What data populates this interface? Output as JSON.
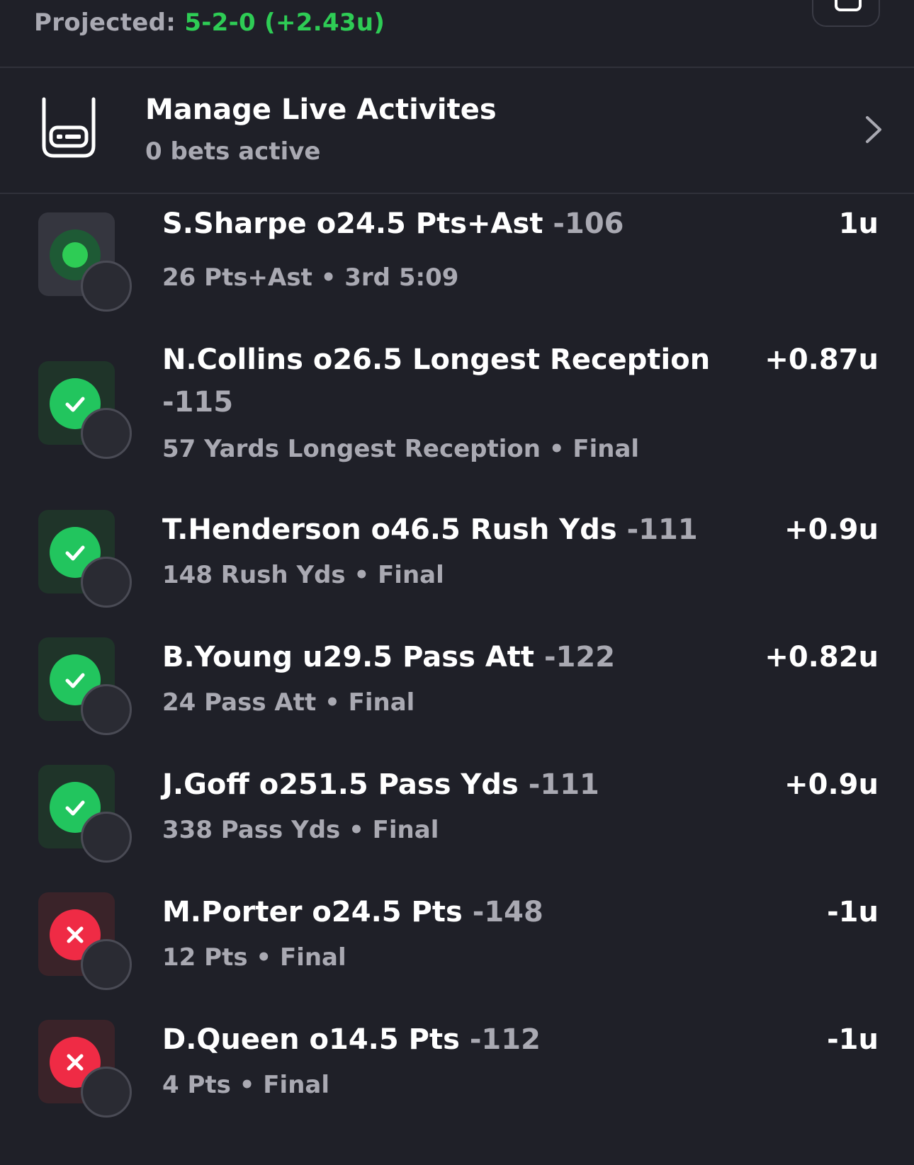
{
  "header": {
    "projected_label": "Projected:",
    "projected_value": "5-2-0 (+2.43u)"
  },
  "live_activities": {
    "title": "Manage Live Activites",
    "subtitle": "0 bets active"
  },
  "colors": {
    "won": "#22c55e",
    "lost": "#ef2b45",
    "projected": "#2ecc55",
    "background": "#1f2028"
  },
  "bets": [
    {
      "player": "S.Sharpe",
      "title": "S.Sharpe o24.5 Pts+Ast",
      "odds": "-106",
      "detail": "26 Pts+Ast • 3rd 5:09",
      "units": "1u",
      "status": "live"
    },
    {
      "player": "N.Collins",
      "title": "N.Collins o26.5 Longest Reception",
      "odds": "-115",
      "detail": "57 Yards Longest Reception • Final",
      "units": "+0.87u",
      "status": "won"
    },
    {
      "player": "T.Henderson",
      "title": "T.Henderson o46.5 Rush Yds",
      "odds": "-111",
      "detail": "148 Rush Yds • Final",
      "units": "+0.9u",
      "status": "won"
    },
    {
      "player": "B.Young",
      "title": "B.Young u29.5 Pass Att",
      "odds": "-122",
      "detail": "24 Pass Att • Final",
      "units": "+0.82u",
      "status": "won"
    },
    {
      "player": "J.Goff",
      "title": "J.Goff o251.5 Pass Yds",
      "odds": "-111",
      "detail": "338 Pass Yds • Final",
      "units": "+0.9u",
      "status": "won"
    },
    {
      "player": "M.Porter",
      "title": "M.Porter o24.5 Pts",
      "odds": "-148",
      "detail": "12 Pts • Final",
      "units": "-1u",
      "status": "lost"
    },
    {
      "player": "D.Queen",
      "title": "D.Queen o14.5 Pts",
      "odds": "-112",
      "detail": "4 Pts • Final",
      "units": "-1u",
      "status": "lost"
    }
  ]
}
